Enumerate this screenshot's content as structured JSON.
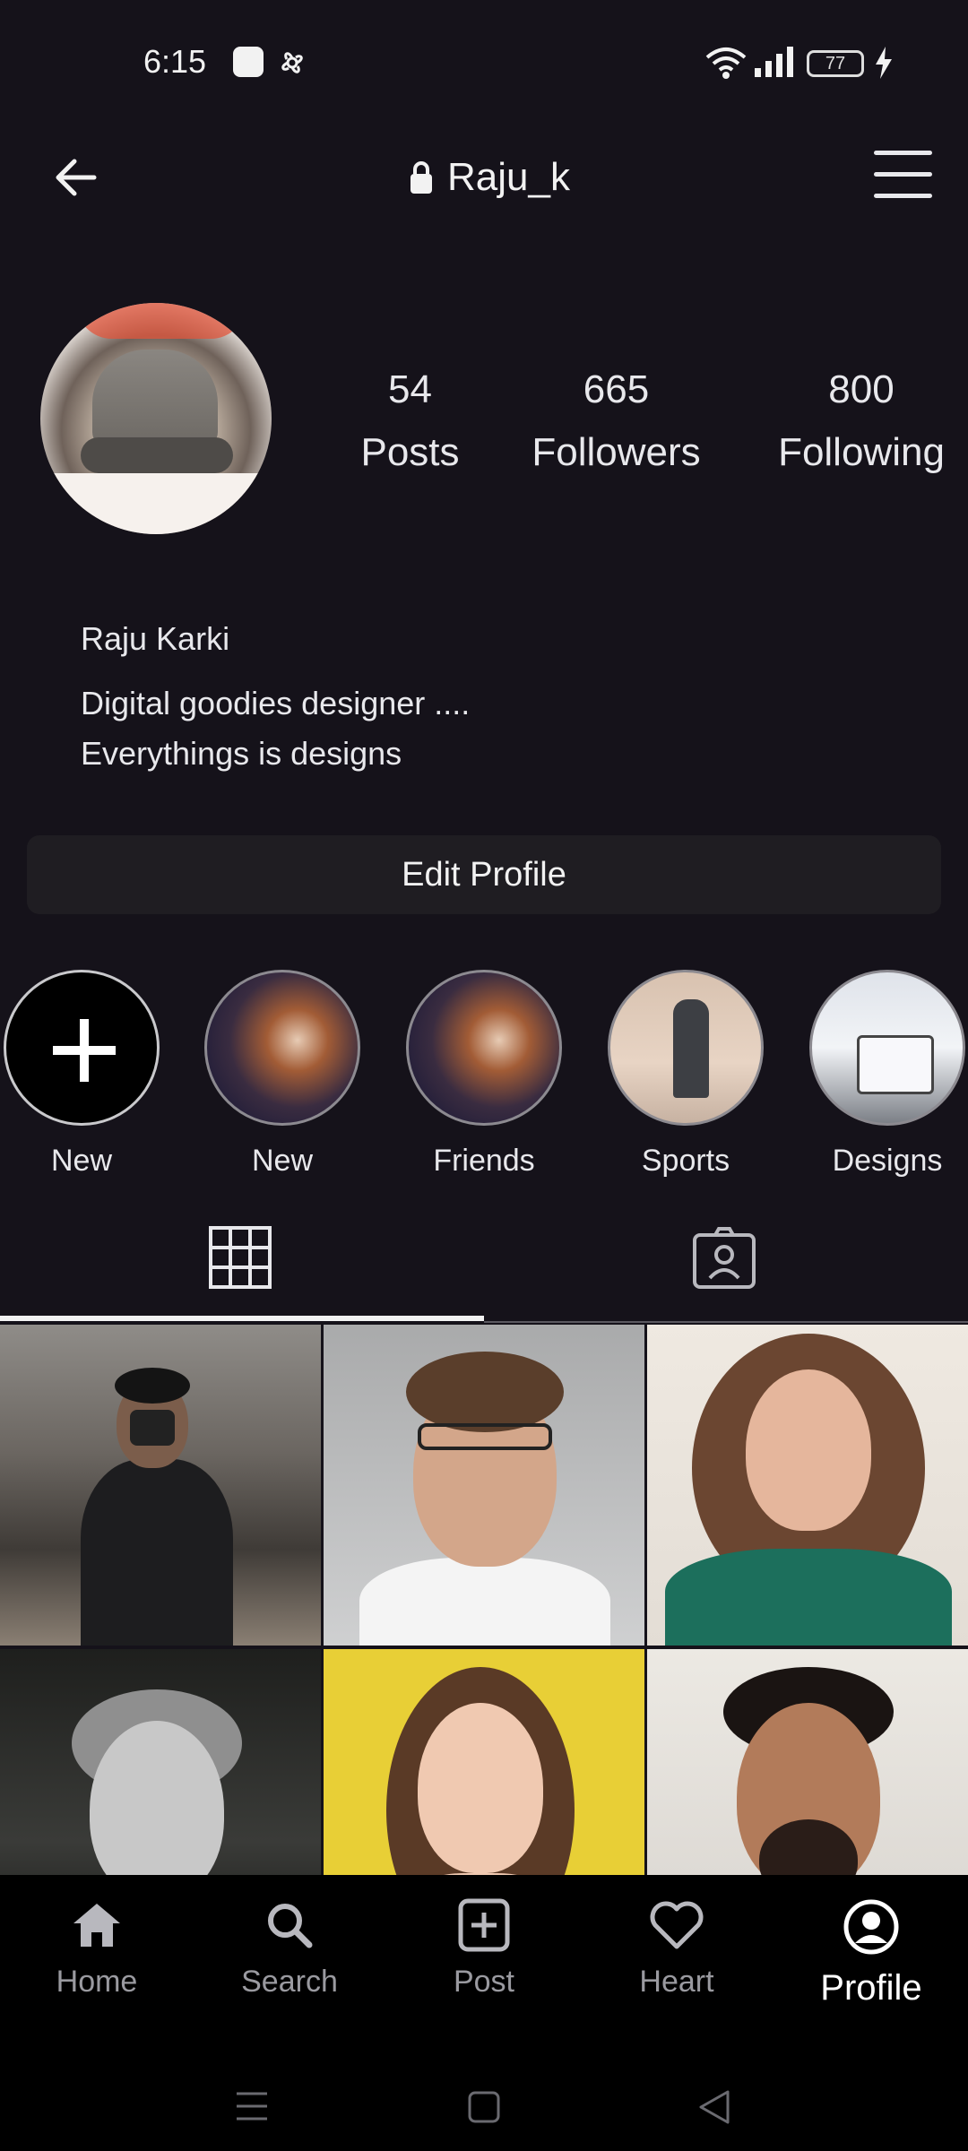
{
  "status_bar": {
    "time": "6:15",
    "battery": "77"
  },
  "header": {
    "username": "Raju_k"
  },
  "stats": [
    {
      "value": "54",
      "label": "Posts"
    },
    {
      "value": "665",
      "label": "Followers"
    },
    {
      "value": "800",
      "label": "Following"
    }
  ],
  "bio": {
    "name": "Raju Karki",
    "line1": "Digital goodies designer ....",
    "line2": "Everythings is designs"
  },
  "edit_profile": {
    "label": "Edit Profile"
  },
  "highlights": [
    {
      "label": "New"
    },
    {
      "label": "New"
    },
    {
      "label": "Friends"
    },
    {
      "label": "Sports"
    },
    {
      "label": "Designs"
    }
  ],
  "nav": [
    {
      "label": "Home",
      "icon": "home-icon"
    },
    {
      "label": "Search",
      "icon": "search-icon"
    },
    {
      "label": "Post",
      "icon": "add-post-icon"
    },
    {
      "label": "Heart",
      "icon": "heart-icon"
    },
    {
      "label": "Profile",
      "icon": "profile-icon"
    }
  ],
  "colors": {
    "background": "#15121a",
    "text": "#e8e8ec",
    "nav_bg": "#000000",
    "button_bg": "#1f1d22"
  }
}
